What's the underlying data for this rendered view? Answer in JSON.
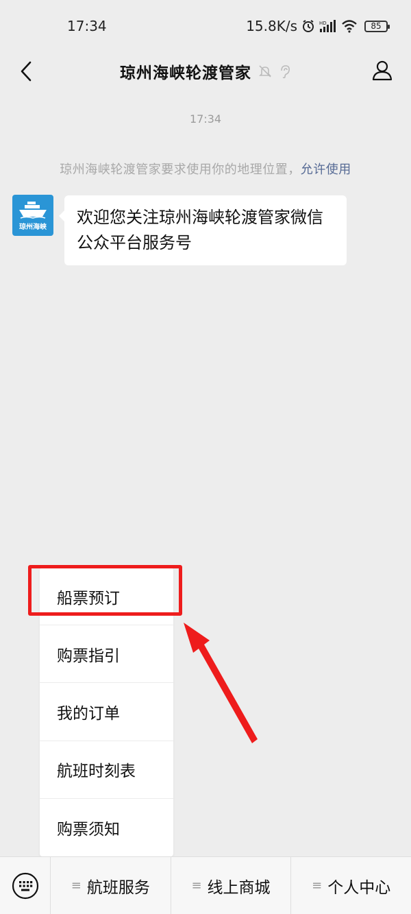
{
  "status_bar": {
    "time": "17:34",
    "network_speed": "15.8K/s",
    "battery": "85",
    "icons": [
      "alarm-icon",
      "hd-signal-icon",
      "wifi-icon",
      "battery-icon"
    ]
  },
  "nav": {
    "title": "琼州海峡轮渡管家",
    "icons": [
      "back-icon",
      "mute-bell-icon",
      "ear-icon",
      "profile-icon"
    ]
  },
  "chat": {
    "timestamp": "17:34",
    "system_text": "琼州海峡轮渡管家要求使用你的地理位置，",
    "system_link": "允许使用",
    "avatar_text": "琼州海峡",
    "message": "欢迎您关注琼州海峡轮渡管家微信公众平台服务号"
  },
  "menu": {
    "items": [
      "船票预订",
      "购票指引",
      "我的订单",
      "航班时刻表",
      "购票须知"
    ]
  },
  "bottom_bar": {
    "tabs": [
      "航班服务",
      "线上商城",
      "个人中心"
    ],
    "tab_icon": "≡"
  },
  "colors": {
    "background": "#ededed",
    "highlight": "#ee1c1c",
    "link": "#576b95",
    "avatar": "#2a95d6"
  }
}
